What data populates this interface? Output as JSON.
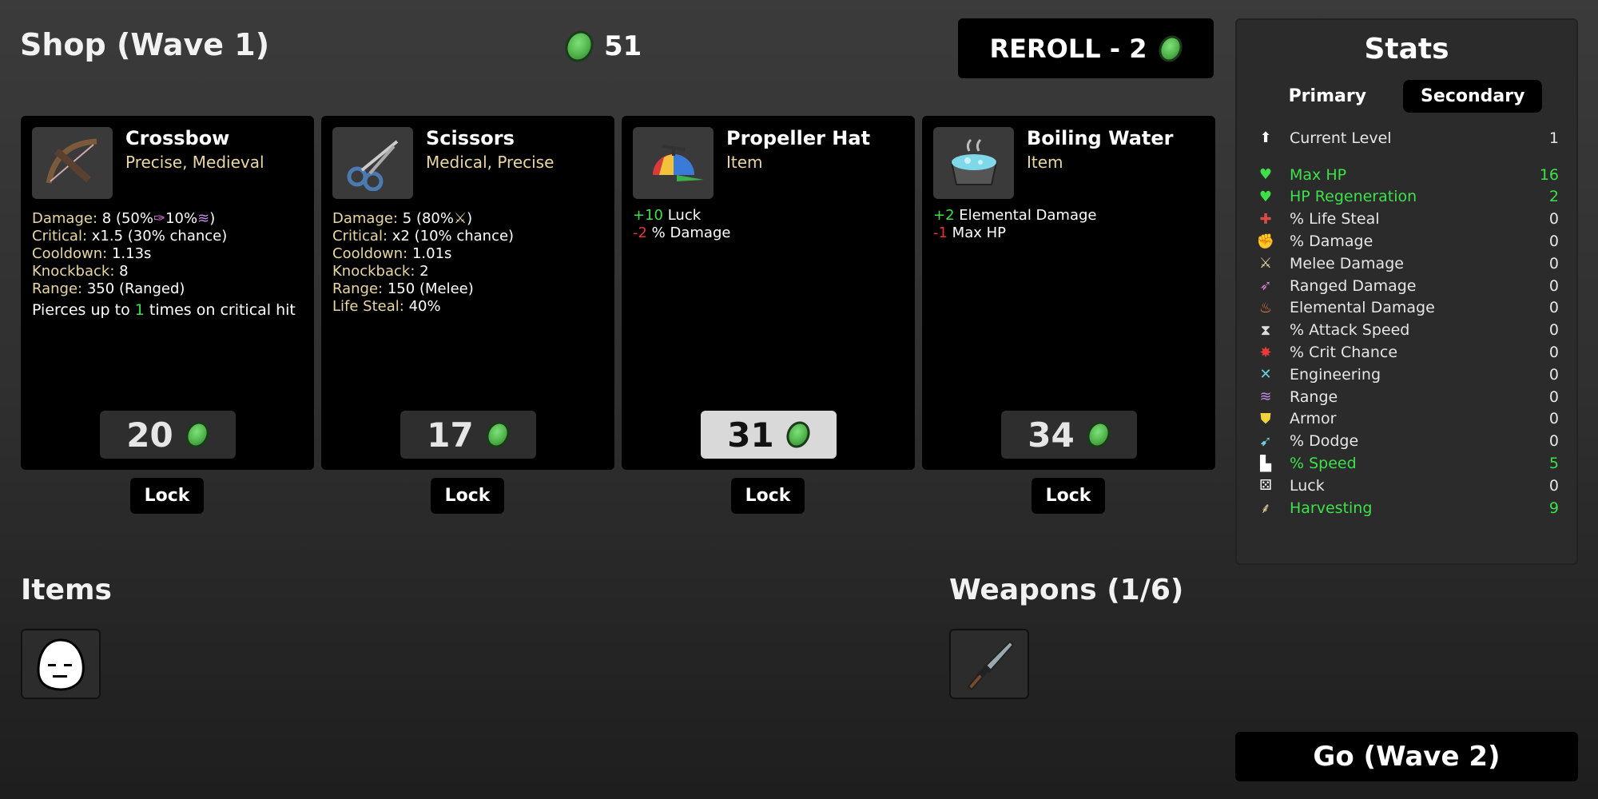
{
  "header": {
    "title": "Shop (Wave 1)",
    "gold": "51",
    "reroll_label": "REROLL - 2"
  },
  "cards": [
    {
      "name": "Crossbow",
      "tags": "Precise, Medieval",
      "price": "20",
      "lock": "Lock",
      "lines": [
        {
          "label": "Damage:",
          "value": "8 (50%",
          "extra": "10%",
          "end": ")"
        },
        {
          "label": "Critical:",
          "value": "x1.5 (30% chance)"
        },
        {
          "label": "Cooldown:",
          "value": "1.13s"
        },
        {
          "label": "Knockback:",
          "value": "8"
        },
        {
          "label": "Range:",
          "value": "350 (Ranged)"
        }
      ],
      "desc_pre": "Pierces up to ",
      "desc_num": "1",
      "desc_post": " times on critical hit"
    },
    {
      "name": "Scissors",
      "tags": "Medical, Precise",
      "price": "17",
      "lock": "Lock",
      "lines": [
        {
          "label": "Damage:",
          "value": "5 (80%",
          "end": ")"
        },
        {
          "label": "Critical:",
          "value": "x2 (10% chance)"
        },
        {
          "label": "Cooldown:",
          "value": "1.01s"
        },
        {
          "label": "Knockback:",
          "value": "2"
        },
        {
          "label": "Range:",
          "value": "150 (Melee)"
        },
        {
          "label": "Life Steal:",
          "value": "40%"
        }
      ]
    },
    {
      "name": "Propeller Hat",
      "tags": "Item",
      "price": "31",
      "lock": "Lock",
      "effects": [
        {
          "num": "+10",
          "text": " Luck",
          "pos": true
        },
        {
          "num": "-2",
          "text": " % Damage",
          "pos": false
        }
      ]
    },
    {
      "name": "Boiling Water",
      "tags": "Item",
      "price": "34",
      "lock": "Lock",
      "effects": [
        {
          "num": "+2",
          "text": " Elemental Damage",
          "pos": true
        },
        {
          "num": "-1",
          "text": " Max HP",
          "pos": false
        }
      ]
    }
  ],
  "items_title": "Items",
  "weapons_title": "Weapons (1/6)",
  "stats": {
    "title": "Stats",
    "tab_primary": "Primary",
    "tab_secondary": "Secondary",
    "rows": [
      {
        "icon": "level-up-icon",
        "label": "Current Level",
        "value": "1",
        "color": "#e6e6e6"
      },
      {
        "icon": "heart-icon",
        "label": "Max HP",
        "value": "16",
        "color": "#3ee04a"
      },
      {
        "icon": "heart-plus-icon",
        "label": "HP Regeneration",
        "value": "2",
        "color": "#3ee04a"
      },
      {
        "icon": "life-steal-icon",
        "label": "% Life Steal",
        "value": "0",
        "color": "#e6e6e6"
      },
      {
        "icon": "fist-icon",
        "label": "% Damage",
        "value": "0",
        "color": "#e6e6e6"
      },
      {
        "icon": "sword-icon",
        "label": "Melee Damage",
        "value": "0",
        "color": "#e6e6e6"
      },
      {
        "icon": "bow-icon",
        "label": "Ranged Damage",
        "value": "0",
        "color": "#e6e6e6"
      },
      {
        "icon": "flame-icon",
        "label": "Elemental Damage",
        "value": "0",
        "color": "#e6e6e6"
      },
      {
        "icon": "hourglass-icon",
        "label": "% Attack Speed",
        "value": "0",
        "color": "#e6e6e6"
      },
      {
        "icon": "crit-icon",
        "label": "% Crit Chance",
        "value": "0",
        "color": "#e6e6e6"
      },
      {
        "icon": "wrench-icon",
        "label": "Engineering",
        "value": "0",
        "color": "#e6e6e6"
      },
      {
        "icon": "range-icon",
        "label": "Range",
        "value": "0",
        "color": "#e6e6e6"
      },
      {
        "icon": "shield-icon",
        "label": "Armor",
        "value": "0",
        "color": "#e6e6e6"
      },
      {
        "icon": "dodge-icon",
        "label": "% Dodge",
        "value": "0",
        "color": "#e6e6e6"
      },
      {
        "icon": "boot-icon",
        "label": "% Speed",
        "value": "5",
        "color": "#3ee04a"
      },
      {
        "icon": "dice-icon",
        "label": "Luck",
        "value": "0",
        "color": "#e6e6e6"
      },
      {
        "icon": "wheat-icon",
        "label": "Harvesting",
        "value": "9",
        "color": "#3ee04a"
      }
    ]
  },
  "go_label": "Go (Wave 2)"
}
